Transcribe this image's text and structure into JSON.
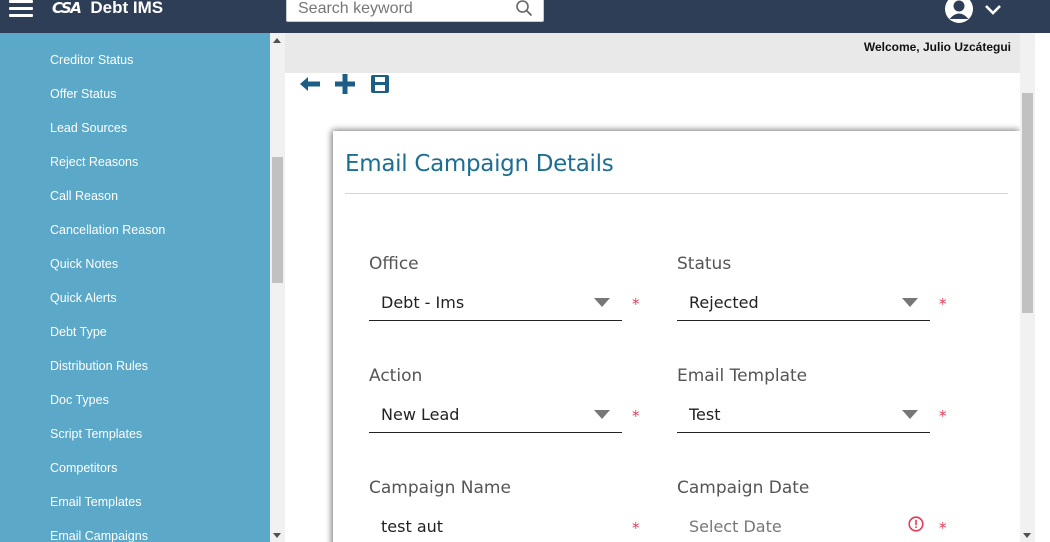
{
  "header": {
    "logo_mark": "CSA",
    "app_name": "Debt IMS",
    "search_placeholder": "Search keyword"
  },
  "sidebar": {
    "items": [
      {
        "label": "Creditor Status"
      },
      {
        "label": "Offer Status"
      },
      {
        "label": "Lead Sources"
      },
      {
        "label": "Reject Reasons"
      },
      {
        "label": "Call Reason"
      },
      {
        "label": "Cancellation Reason"
      },
      {
        "label": "Quick Notes"
      },
      {
        "label": "Quick Alerts"
      },
      {
        "label": "Debt Type"
      },
      {
        "label": "Distribution Rules"
      },
      {
        "label": "Doc Types"
      },
      {
        "label": "Script Templates"
      },
      {
        "label": "Competitors"
      },
      {
        "label": "Email Templates"
      },
      {
        "label": "Email Campaigns"
      }
    ]
  },
  "welcome": "Welcome, Julio Uzcátegui",
  "toolbar": {
    "icons": [
      "arrow-left-icon",
      "plus-icon",
      "save-icon"
    ]
  },
  "form": {
    "title": "Email Campaign Details",
    "required_mark": "*",
    "office": {
      "label": "Office",
      "value": "Debt - Ims"
    },
    "status": {
      "label": "Status",
      "value": "Rejected"
    },
    "action": {
      "label": "Action",
      "value": "New Lead"
    },
    "email_template": {
      "label": "Email Template",
      "value": "Test"
    },
    "campaign_name": {
      "label": "Campaign Name",
      "value": "test aut"
    },
    "campaign_date": {
      "label": "Campaign Date",
      "placeholder": "Select Date"
    }
  },
  "colors": {
    "topbar": "#2e3e57",
    "sidebar": "#5ba8c9",
    "title": "#1d6e94",
    "required": "#e53955"
  }
}
